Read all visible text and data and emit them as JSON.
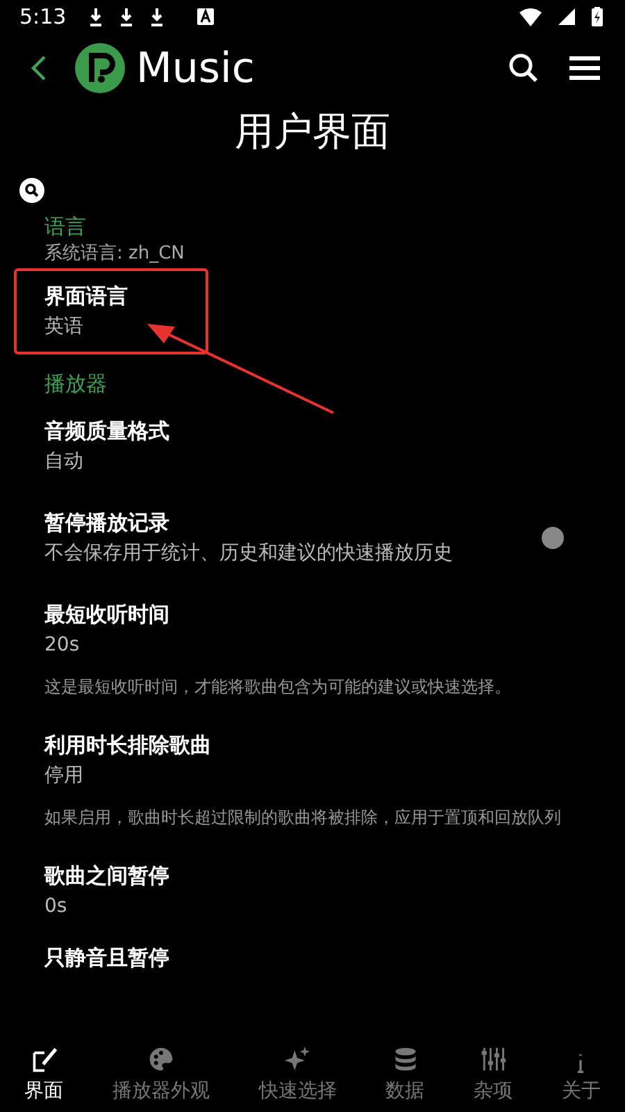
{
  "status_bar": {
    "time": "5:13"
  },
  "app_bar": {
    "app_name": "Music"
  },
  "page_title": "用户界面",
  "sections": [
    {
      "title": "语言",
      "subtitle": "系统语言: zh_CN",
      "items": [
        {
          "kind": "value",
          "title": "界面语言",
          "value": "英语",
          "highlighted": true
        }
      ]
    },
    {
      "title": "播放器",
      "items": [
        {
          "kind": "value",
          "title": "音频质量格式",
          "value": "自动"
        },
        {
          "kind": "toggle",
          "title": "暂停播放记录",
          "value": "不会保存用于统计、历史和建议的快速播放历史",
          "on": false
        },
        {
          "kind": "value",
          "title": "最短收听时间",
          "value": "20s",
          "note": "这是最短收听时间，才能将歌曲包含为可能的建议或快速选择。"
        },
        {
          "kind": "value",
          "title": "利用时长排除歌曲",
          "value": "停用",
          "note": "如果启用，歌曲时长超过限制的歌曲将被排除，应用于置顶和回放队列"
        },
        {
          "kind": "value",
          "title": "歌曲之间暂停",
          "value": "0s"
        },
        {
          "kind": "title",
          "title": "只静音且暂停"
        }
      ]
    }
  ],
  "nav": [
    {
      "label": "界面",
      "selected": true
    },
    {
      "label": "播放器外观",
      "selected": false
    },
    {
      "label": "快速选择",
      "selected": false
    },
    {
      "label": "数据",
      "selected": false
    },
    {
      "label": "杂项",
      "selected": false
    },
    {
      "label": "关于",
      "selected": false
    }
  ]
}
